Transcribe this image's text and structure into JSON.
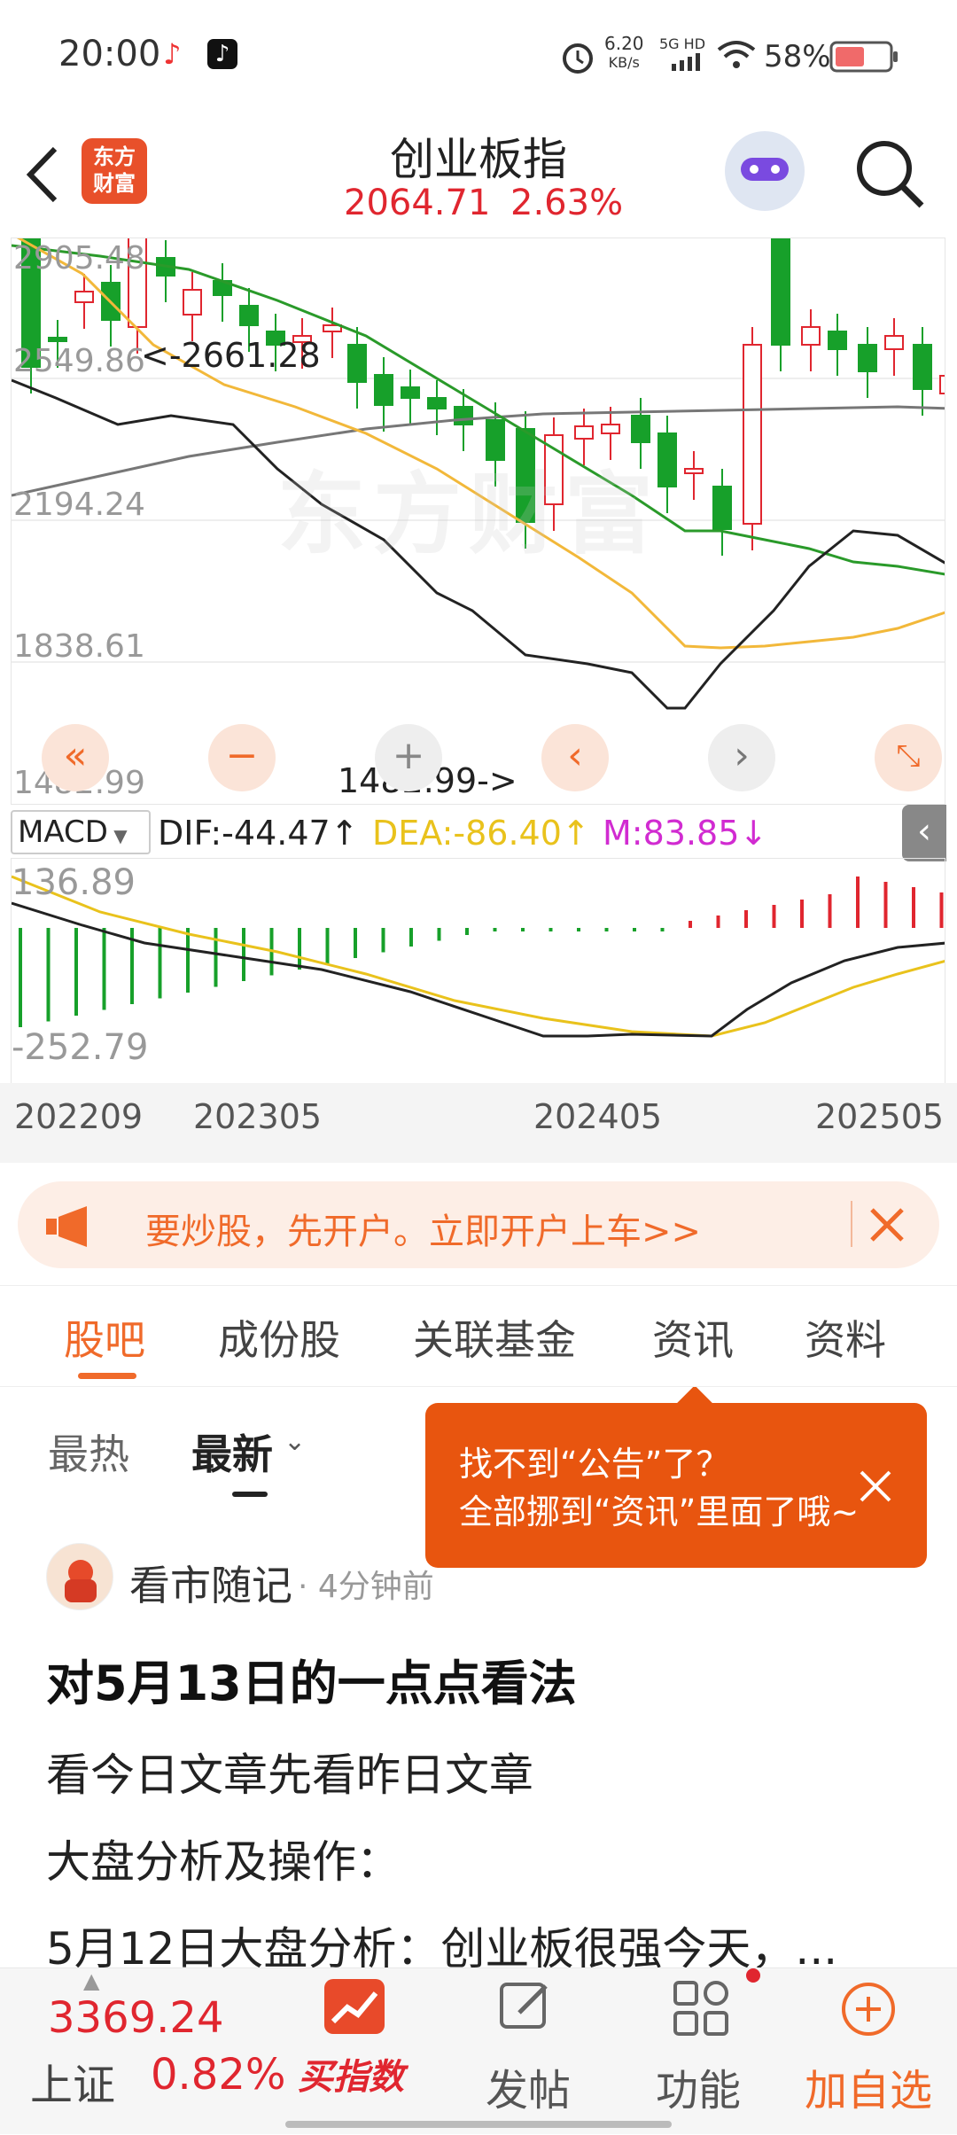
{
  "status_bar": {
    "time": "20:00",
    "net_speed": "6.20",
    "net_unit": "KB/s",
    "net_type": "5G HD",
    "battery": "58%"
  },
  "header": {
    "logo_line1": "东方",
    "logo_line2": "财富",
    "title": "创业板指",
    "price": "2064.71",
    "change": "2.63%"
  },
  "chart": {
    "y_labels": [
      "2905.48",
      "2549.86",
      "2194.24",
      "1838.61",
      "1482.99"
    ],
    "high_annotation": "<-2661.28",
    "low_annotation": "1482.99->",
    "watermark": "东方财富"
  },
  "macd_bar": {
    "indicator": "MACD",
    "dif": "DIF:-44.47",
    "dea": "DEA:-86.40",
    "m": "M:83.85",
    "dif_arrow": "↑",
    "dea_arrow": "↑",
    "m_arrow": "↓",
    "macd_top": "136.89",
    "macd_bottom": "-252.79"
  },
  "x_axis": [
    "202209",
    "202305",
    "202405",
    "202505"
  ],
  "banner": {
    "text": "要炒股，先开户。立即开户上车>>"
  },
  "tabs": [
    "股吧",
    "成份股",
    "关联基金",
    "资讯",
    "资料"
  ],
  "feed": {
    "sort_hot": "最热",
    "sort_new": "最新",
    "author": "看市随记",
    "time": "· 4分钟前",
    "post_title": "对5月13日的一点点看法",
    "post_line1": "看今日文章先看昨日文章",
    "post_line2": "大盘分析及操作：",
    "post_line3": "5月12日大盘分析：创业板很强今天，...",
    "tooltip_line1": "找不到“公告”了？",
    "tooltip_line2": "全部挪到“资讯”里面了哦~"
  },
  "bottom": {
    "index_value": "3369.24",
    "index_name": "上证",
    "index_change": "0.82%",
    "buy_index": "买指数",
    "post": "发帖",
    "functions": "功能",
    "add_watch": "加自选"
  },
  "colors": {
    "up": "#e0262f",
    "down": "#17a02a",
    "accent": "#f06a2a",
    "ma_yellow": "#f2b83a",
    "macd_yellow": "#e9c21c",
    "macd_m": "#d12bd1"
  }
}
